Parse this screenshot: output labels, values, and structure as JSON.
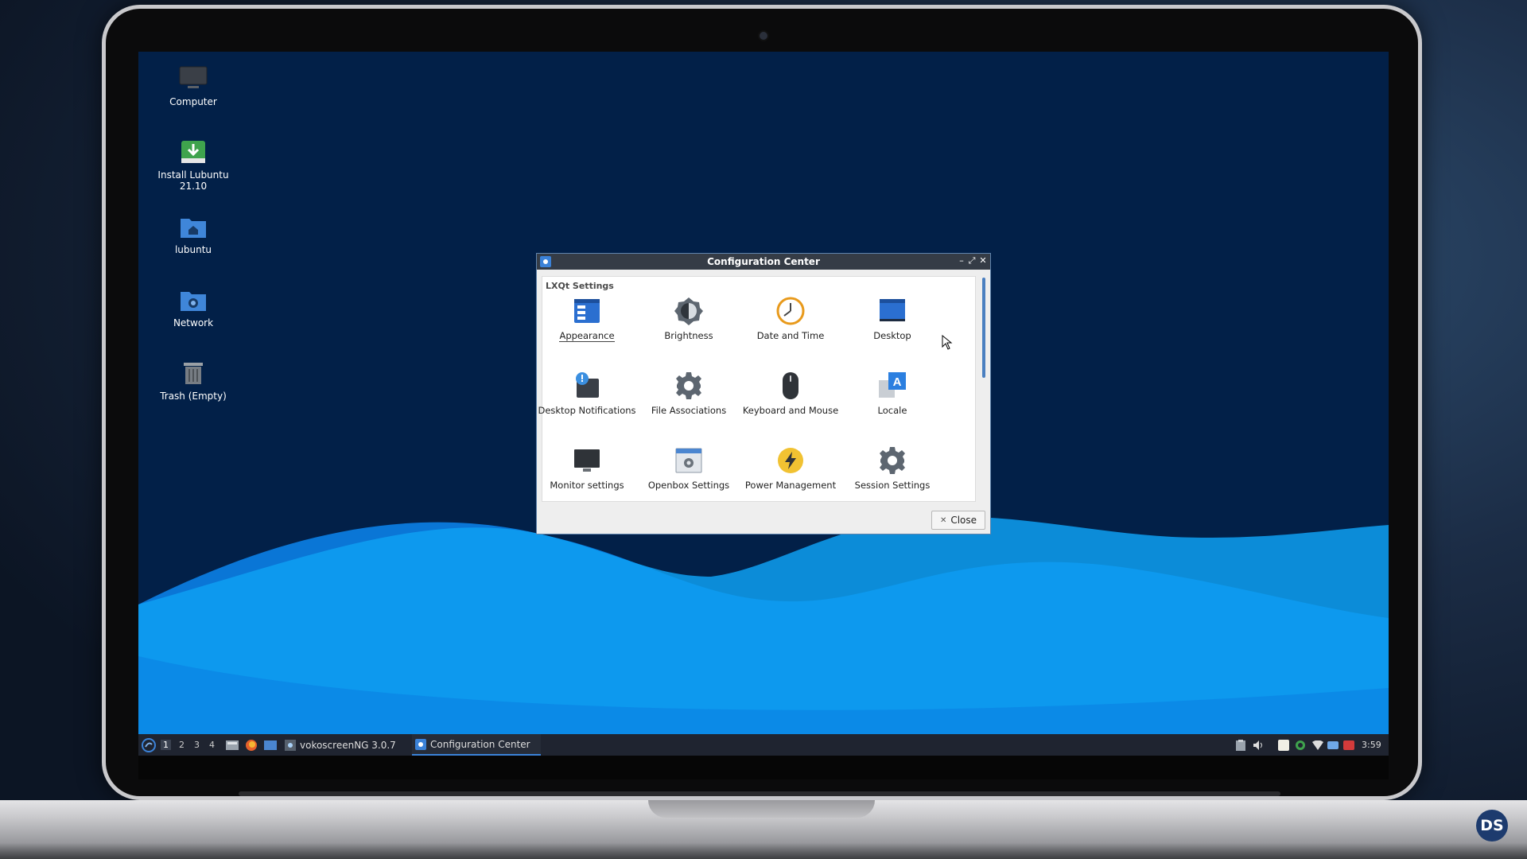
{
  "desktop": {
    "icons": [
      {
        "label": "Computer",
        "icon": "computer-icon"
      },
      {
        "label": "Install Lubuntu\n21.10",
        "icon": "install-icon"
      },
      {
        "label": "lubuntu",
        "icon": "home-folder-icon"
      },
      {
        "label": "Network",
        "icon": "network-folder-icon"
      },
      {
        "label": "Trash (Empty)",
        "icon": "trash-icon"
      }
    ]
  },
  "window": {
    "title": "Configuration Center",
    "section": "LXQt Settings",
    "items": [
      {
        "label": "Appearance",
        "icon": "appearance-icon",
        "selected": true
      },
      {
        "label": "Brightness",
        "icon": "brightness-icon"
      },
      {
        "label": "Date and Time",
        "icon": "clock-icon"
      },
      {
        "label": "Desktop",
        "icon": "desktop-icon"
      },
      {
        "label": "Desktop Notifications",
        "icon": "notifications-icon"
      },
      {
        "label": "File Associations",
        "icon": "gear-icon"
      },
      {
        "label": "Keyboard and Mouse",
        "icon": "mouse-icon"
      },
      {
        "label": "Locale",
        "icon": "locale-icon"
      },
      {
        "label": "Monitor settings",
        "icon": "monitor-icon"
      },
      {
        "label": "Openbox Settings",
        "icon": "openbox-icon"
      },
      {
        "label": "Power Management",
        "icon": "power-icon"
      },
      {
        "label": "Session Settings",
        "icon": "gear-icon"
      }
    ],
    "close_label": "Close",
    "close_glyph": "✕",
    "controls": {
      "minimize": "–",
      "maximize": "⤢",
      "close": "✕"
    }
  },
  "taskbar": {
    "workspaces": [
      "1",
      "2",
      "3",
      "4"
    ],
    "tasks": [
      {
        "label": "vokoscreenNG 3.0.7"
      },
      {
        "label": "Configuration Center",
        "active": true
      }
    ],
    "clock": "3:59"
  },
  "watermark": "DS",
  "colors": {
    "accent": "#3b82d8",
    "desktop_bg": "#022048",
    "wave_light": "#0ea0f2",
    "wave_dark": "#0a76d6"
  }
}
